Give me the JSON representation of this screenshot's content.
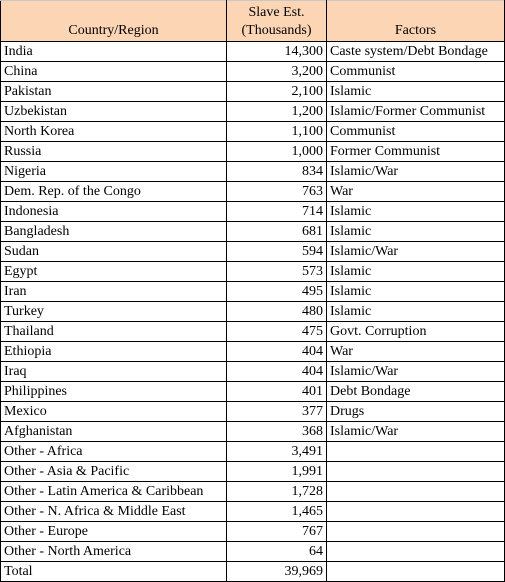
{
  "header": {
    "country": "Country/Region",
    "estimate_line1": "Slave Est.",
    "estimate_line2": "(Thousands)",
    "factors": "Factors"
  },
  "header_color": "#fcd5b4",
  "rows": [
    {
      "country": "India",
      "estimate": "14,300",
      "factors": "Caste system/Debt Bondage"
    },
    {
      "country": "China",
      "estimate": "3,200",
      "factors": "Communist"
    },
    {
      "country": "Pakistan",
      "estimate": "2,100",
      "factors": "Islamic"
    },
    {
      "country": "Uzbekistan",
      "estimate": "1,200",
      "factors": "Islamic/Former Communist"
    },
    {
      "country": "North Korea",
      "estimate": "1,100",
      "factors": "Communist"
    },
    {
      "country": "Russia",
      "estimate": "1,000",
      "factors": "Former Communist"
    },
    {
      "country": "Nigeria",
      "estimate": "834",
      "factors": "Islamic/War"
    },
    {
      "country": "Dem. Rep. of the Congo",
      "estimate": "763",
      "factors": "War"
    },
    {
      "country": "Indonesia",
      "estimate": "714",
      "factors": "Islamic"
    },
    {
      "country": "Bangladesh",
      "estimate": "681",
      "factors": "Islamic"
    },
    {
      "country": "Sudan",
      "estimate": "594",
      "factors": "Islamic/War"
    },
    {
      "country": "Egypt",
      "estimate": "573",
      "factors": "Islamic"
    },
    {
      "country": "Iran",
      "estimate": "495",
      "factors": "Islamic"
    },
    {
      "country": "Turkey",
      "estimate": "480",
      "factors": "Islamic"
    },
    {
      "country": "Thailand",
      "estimate": "475",
      "factors": "Govt. Corruption"
    },
    {
      "country": "Ethiopia",
      "estimate": "404",
      "factors": "War"
    },
    {
      "country": "Iraq",
      "estimate": "404",
      "factors": "Islamic/War"
    },
    {
      "country": "Philippines",
      "estimate": "401",
      "factors": "Debt Bondage"
    },
    {
      "country": "Mexico",
      "estimate": "377",
      "factors": "Drugs"
    },
    {
      "country": "Afghanistan",
      "estimate": "368",
      "factors": "Islamic/War"
    },
    {
      "country": "Other - Africa",
      "estimate": "3,491",
      "factors": ""
    },
    {
      "country": "Other - Asia & Pacific",
      "estimate": "1,991",
      "factors": ""
    },
    {
      "country": "Other - Latin America & Caribbean",
      "estimate": "1,728",
      "factors": ""
    },
    {
      "country": "Other - N. Africa & Middle East",
      "estimate": "1,465",
      "factors": ""
    },
    {
      "country": "Other - Europe",
      "estimate": "767",
      "factors": ""
    },
    {
      "country": "Other - North America",
      "estimate": "64",
      "factors": ""
    },
    {
      "country": "Total",
      "estimate": "39,969",
      "factors": ""
    }
  ]
}
